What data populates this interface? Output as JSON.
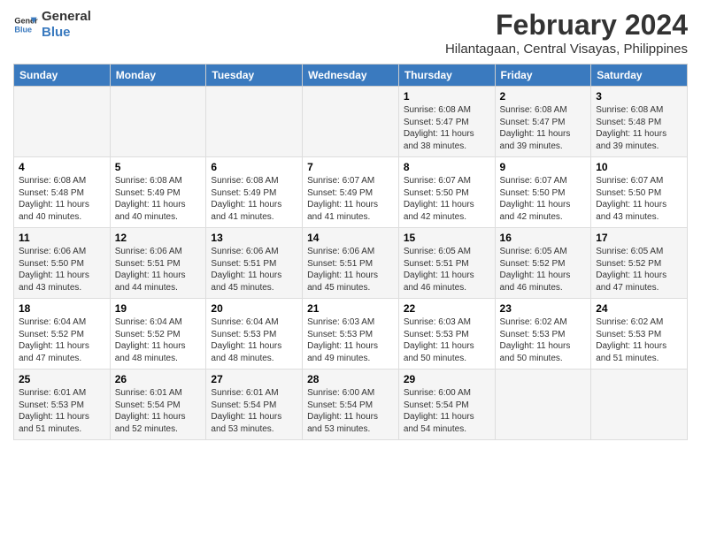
{
  "logo": {
    "line1": "General",
    "line2": "Blue"
  },
  "title": "February 2024",
  "subtitle": "Hilantagaan, Central Visayas, Philippines",
  "days_header": [
    "Sunday",
    "Monday",
    "Tuesday",
    "Wednesday",
    "Thursday",
    "Friday",
    "Saturday"
  ],
  "weeks": [
    [
      {
        "num": "",
        "info": ""
      },
      {
        "num": "",
        "info": ""
      },
      {
        "num": "",
        "info": ""
      },
      {
        "num": "",
        "info": ""
      },
      {
        "num": "1",
        "info": "Sunrise: 6:08 AM\nSunset: 5:47 PM\nDaylight: 11 hours\nand 38 minutes."
      },
      {
        "num": "2",
        "info": "Sunrise: 6:08 AM\nSunset: 5:47 PM\nDaylight: 11 hours\nand 39 minutes."
      },
      {
        "num": "3",
        "info": "Sunrise: 6:08 AM\nSunset: 5:48 PM\nDaylight: 11 hours\nand 39 minutes."
      }
    ],
    [
      {
        "num": "4",
        "info": "Sunrise: 6:08 AM\nSunset: 5:48 PM\nDaylight: 11 hours\nand 40 minutes."
      },
      {
        "num": "5",
        "info": "Sunrise: 6:08 AM\nSunset: 5:49 PM\nDaylight: 11 hours\nand 40 minutes."
      },
      {
        "num": "6",
        "info": "Sunrise: 6:08 AM\nSunset: 5:49 PM\nDaylight: 11 hours\nand 41 minutes."
      },
      {
        "num": "7",
        "info": "Sunrise: 6:07 AM\nSunset: 5:49 PM\nDaylight: 11 hours\nand 41 minutes."
      },
      {
        "num": "8",
        "info": "Sunrise: 6:07 AM\nSunset: 5:50 PM\nDaylight: 11 hours\nand 42 minutes."
      },
      {
        "num": "9",
        "info": "Sunrise: 6:07 AM\nSunset: 5:50 PM\nDaylight: 11 hours\nand 42 minutes."
      },
      {
        "num": "10",
        "info": "Sunrise: 6:07 AM\nSunset: 5:50 PM\nDaylight: 11 hours\nand 43 minutes."
      }
    ],
    [
      {
        "num": "11",
        "info": "Sunrise: 6:06 AM\nSunset: 5:50 PM\nDaylight: 11 hours\nand 43 minutes."
      },
      {
        "num": "12",
        "info": "Sunrise: 6:06 AM\nSunset: 5:51 PM\nDaylight: 11 hours\nand 44 minutes."
      },
      {
        "num": "13",
        "info": "Sunrise: 6:06 AM\nSunset: 5:51 PM\nDaylight: 11 hours\nand 45 minutes."
      },
      {
        "num": "14",
        "info": "Sunrise: 6:06 AM\nSunset: 5:51 PM\nDaylight: 11 hours\nand 45 minutes."
      },
      {
        "num": "15",
        "info": "Sunrise: 6:05 AM\nSunset: 5:51 PM\nDaylight: 11 hours\nand 46 minutes."
      },
      {
        "num": "16",
        "info": "Sunrise: 6:05 AM\nSunset: 5:52 PM\nDaylight: 11 hours\nand 46 minutes."
      },
      {
        "num": "17",
        "info": "Sunrise: 6:05 AM\nSunset: 5:52 PM\nDaylight: 11 hours\nand 47 minutes."
      }
    ],
    [
      {
        "num": "18",
        "info": "Sunrise: 6:04 AM\nSunset: 5:52 PM\nDaylight: 11 hours\nand 47 minutes."
      },
      {
        "num": "19",
        "info": "Sunrise: 6:04 AM\nSunset: 5:52 PM\nDaylight: 11 hours\nand 48 minutes."
      },
      {
        "num": "20",
        "info": "Sunrise: 6:04 AM\nSunset: 5:53 PM\nDaylight: 11 hours\nand 48 minutes."
      },
      {
        "num": "21",
        "info": "Sunrise: 6:03 AM\nSunset: 5:53 PM\nDaylight: 11 hours\nand 49 minutes."
      },
      {
        "num": "22",
        "info": "Sunrise: 6:03 AM\nSunset: 5:53 PM\nDaylight: 11 hours\nand 50 minutes."
      },
      {
        "num": "23",
        "info": "Sunrise: 6:02 AM\nSunset: 5:53 PM\nDaylight: 11 hours\nand 50 minutes."
      },
      {
        "num": "24",
        "info": "Sunrise: 6:02 AM\nSunset: 5:53 PM\nDaylight: 11 hours\nand 51 minutes."
      }
    ],
    [
      {
        "num": "25",
        "info": "Sunrise: 6:01 AM\nSunset: 5:53 PM\nDaylight: 11 hours\nand 51 minutes."
      },
      {
        "num": "26",
        "info": "Sunrise: 6:01 AM\nSunset: 5:54 PM\nDaylight: 11 hours\nand 52 minutes."
      },
      {
        "num": "27",
        "info": "Sunrise: 6:01 AM\nSunset: 5:54 PM\nDaylight: 11 hours\nand 53 minutes."
      },
      {
        "num": "28",
        "info": "Sunrise: 6:00 AM\nSunset: 5:54 PM\nDaylight: 11 hours\nand 53 minutes."
      },
      {
        "num": "29",
        "info": "Sunrise: 6:00 AM\nSunset: 5:54 PM\nDaylight: 11 hours\nand 54 minutes."
      },
      {
        "num": "",
        "info": ""
      },
      {
        "num": "",
        "info": ""
      }
    ]
  ]
}
